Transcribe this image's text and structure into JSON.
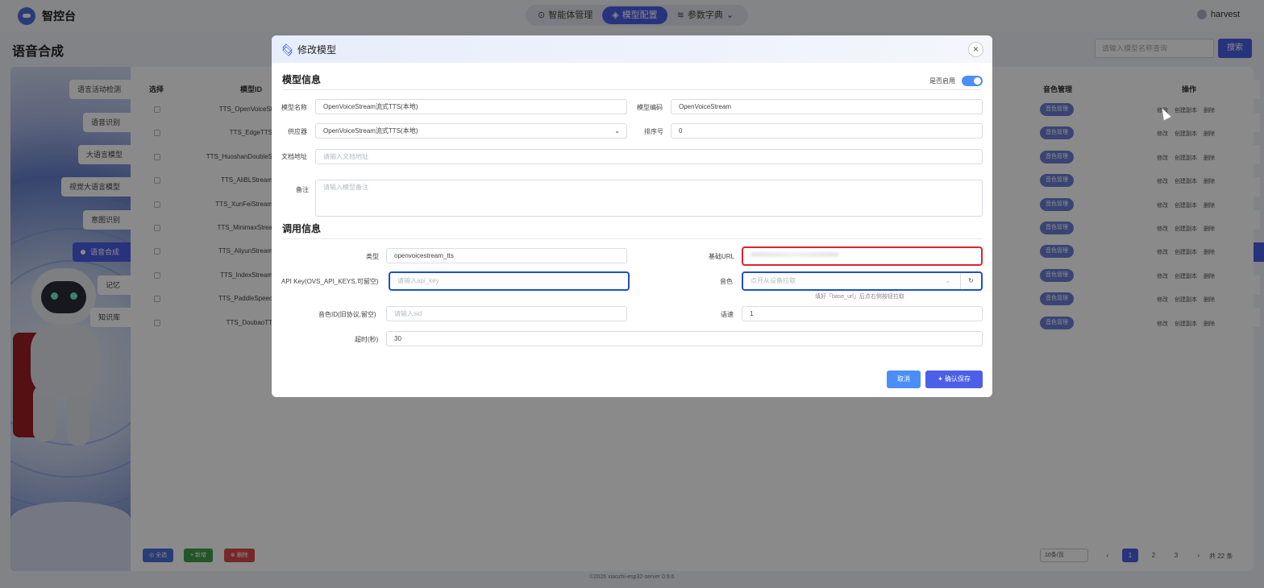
{
  "app": {
    "name": "智控台",
    "user": "harvest"
  },
  "nav": [
    {
      "label": "智能体管理",
      "icon": "agent-icon"
    },
    {
      "label": "模型配置",
      "icon": "layers-icon"
    },
    {
      "label": "参数字典",
      "icon": "sliders-icon"
    }
  ],
  "page": {
    "title": "语音合成",
    "search_placeholder": "请输入模型名称查询",
    "search_button": "搜索"
  },
  "sidebar": {
    "items": [
      "语言活动检测",
      "语音识别",
      "大语言模型",
      "视觉大语言模型",
      "意图识别",
      "语音合成",
      "记忆",
      "知识库"
    ],
    "active": "语音合成"
  },
  "table": {
    "headers": [
      "选择",
      "模型ID",
      "音色管理",
      "操作"
    ],
    "rows": [
      "TTS_OpenVoiceSt",
      "TTS_EdgeTTS",
      "TTS_HuoshanDoubleS",
      "TTS_AliBLStream",
      "TTS_XunFeiStream",
      "TTS_MinimaxStrea",
      "TTS_AliyunStream",
      "TTS_IndexStream",
      "TTS_PaddleSpeec",
      "TTS_DoubaoTT"
    ],
    "voice_label": "音色管理",
    "ops": [
      "修改",
      "创建副本",
      "删除"
    ]
  },
  "bottom": {
    "select_all": "全选",
    "add": "新增",
    "delete": "删除"
  },
  "pagination": {
    "page_size": "10条/页",
    "pages": [
      "1",
      "2",
      "3"
    ],
    "total": "共 22 条"
  },
  "footer": "©2026 xiaozhi-esp32-server 0.9.6",
  "modal": {
    "title": "修改模型",
    "section_model": "模型信息",
    "enable_label": "是否启用",
    "enabled": true,
    "model_name_label": "模型名称",
    "model_name": "OpenVoiceStream流式TTS(本地)",
    "model_code_label": "模型编码",
    "model_code": "OpenVoiceStream",
    "provider_label": "供应器",
    "provider": "OpenVoiceStream流式TTS(本地)",
    "sort_label": "排序号",
    "sort": "0",
    "doc_label": "文档地址",
    "doc_placeholder": "请输入文档地址",
    "remark_label": "备注",
    "remark_placeholder": "请输入模型备注",
    "section_call": "调用信息",
    "type_label": "类型",
    "type": "openvoicestream_tts",
    "base_url_label": "基础URL",
    "api_key_label": "API Key(OVS_API_KEYS,可留空)",
    "api_key_placeholder": "请输入api_key",
    "voice_label": "音色",
    "voice_placeholder": "点开从设备拉取",
    "voice_hint": "填好「base_url」后点右侧按钮拉取",
    "voice_id_label": "音色ID(旧协议,留空)",
    "voice_id_placeholder": "请输入sid",
    "speed_label": "语速",
    "speed": "1",
    "timeout_label": "超时(秒)",
    "timeout": "30",
    "cancel": "取消",
    "save": "确认保存"
  }
}
